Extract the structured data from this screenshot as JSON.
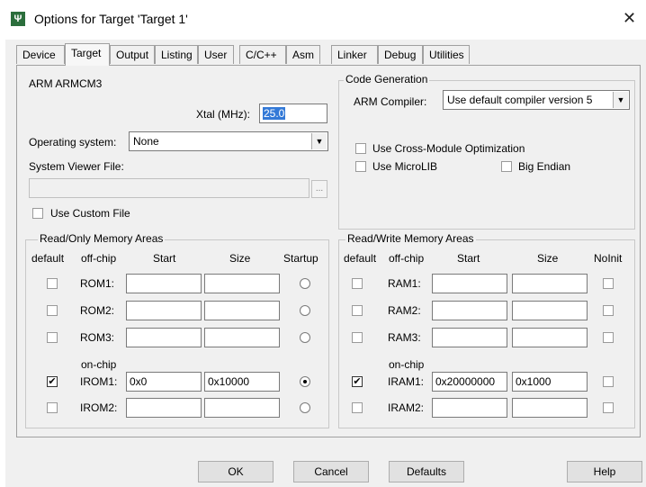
{
  "window": {
    "title": "Options for Target 'Target 1'",
    "app_icon": "Ψ",
    "close_glyph": "✕"
  },
  "tabs": [
    {
      "label": "Device"
    },
    {
      "label": "Target",
      "active": true
    },
    {
      "label": "Output"
    },
    {
      "label": "Listing"
    },
    {
      "label": "User"
    },
    {
      "label": "C/C++"
    },
    {
      "label": "Asm"
    },
    {
      "label": "Linker"
    },
    {
      "label": "Debug"
    },
    {
      "label": "Utilities"
    }
  ],
  "target": {
    "device_name": "ARM ARMCM3",
    "xtal_label": "Xtal (MHz):",
    "xtal_value": "25.0",
    "os_label": "Operating system:",
    "os_value": "None",
    "svd_label": "System Viewer File:",
    "svd_value": "",
    "browse_label": "...",
    "use_custom_file_label": "Use Custom File",
    "use_custom_file_checked": false
  },
  "code_generation": {
    "title": "Code Generation",
    "compiler_label": "ARM Compiler:",
    "compiler_value": "Use default compiler version 5",
    "cross_module_label": "Use Cross-Module Optimization",
    "cross_module_checked": false,
    "microlib_label": "Use MicroLIB",
    "microlib_checked": false,
    "big_endian_label": "Big Endian",
    "big_endian_checked": false
  },
  "ro_memory": {
    "title": "Read/Only Memory Areas",
    "col_default": "default",
    "col_offchip": "off-chip",
    "col_start": "Start",
    "col_size": "Size",
    "col_startup": "Startup",
    "onchip_label": "on-chip",
    "rows": [
      {
        "name": "ROM1:",
        "start": "",
        "size": "",
        "default": false,
        "startup": false
      },
      {
        "name": "ROM2:",
        "start": "",
        "size": "",
        "default": false,
        "startup": false
      },
      {
        "name": "ROM3:",
        "start": "",
        "size": "",
        "default": false,
        "startup": false
      },
      {
        "name": "IROM1:",
        "start": "0x0",
        "size": "0x10000",
        "default": true,
        "startup": true
      },
      {
        "name": "IROM2:",
        "start": "",
        "size": "",
        "default": false,
        "startup": false
      }
    ]
  },
  "rw_memory": {
    "title": "Read/Write Memory Areas",
    "col_default": "default",
    "col_offchip": "off-chip",
    "col_start": "Start",
    "col_size": "Size",
    "col_noinit": "NoInit",
    "onchip_label": "on-chip",
    "rows": [
      {
        "name": "RAM1:",
        "start": "",
        "size": "",
        "default": false,
        "noinit": false
      },
      {
        "name": "RAM2:",
        "start": "",
        "size": "",
        "default": false,
        "noinit": false
      },
      {
        "name": "RAM3:",
        "start": "",
        "size": "",
        "default": false,
        "noinit": false
      },
      {
        "name": "IRAM1:",
        "start": "0x20000000",
        "size": "0x1000",
        "default": true,
        "noinit": false
      },
      {
        "name": "IRAM2:",
        "start": "",
        "size": "",
        "default": false,
        "noinit": false
      }
    ]
  },
  "buttons": {
    "ok": "OK",
    "cancel": "Cancel",
    "defaults": "Defaults",
    "help": "Help"
  },
  "colors": {
    "dialog_bg": "#f0f0f0",
    "selection": "#3379d7",
    "title_icon": "#2b6e3c"
  },
  "icons": {
    "app": "keil-uvision-icon",
    "close": "close-icon",
    "combo_arrow": "chevron-down-icon",
    "check": "✔"
  }
}
